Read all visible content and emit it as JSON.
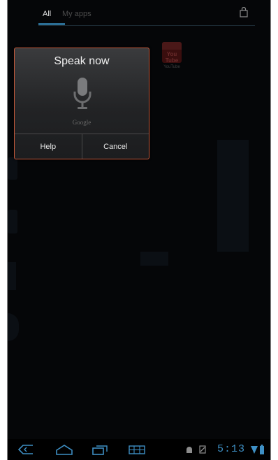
{
  "tabs": [
    {
      "label": "All",
      "active": true
    },
    {
      "label": "My apps",
      "active": false
    }
  ],
  "apps": [
    {
      "icon_text": "You Tube",
      "label": "YouTube"
    }
  ],
  "dialog": {
    "title": "Speak now",
    "icon": "microphone-icon",
    "brand": "Google",
    "buttons": {
      "help": "Help",
      "cancel": "Cancel"
    }
  },
  "system_bar": {
    "nav_icons": [
      "back-icon",
      "home-icon",
      "recent-apps-icon",
      "screenshot-icon"
    ],
    "status_icons": [
      "android-icon",
      "usb-icon",
      "wifi-icon",
      "battery-icon"
    ],
    "time": "5:13"
  },
  "colors": {
    "accent": "#3e8fc4",
    "dialog_border": "#c4593a",
    "background": "#050608"
  }
}
